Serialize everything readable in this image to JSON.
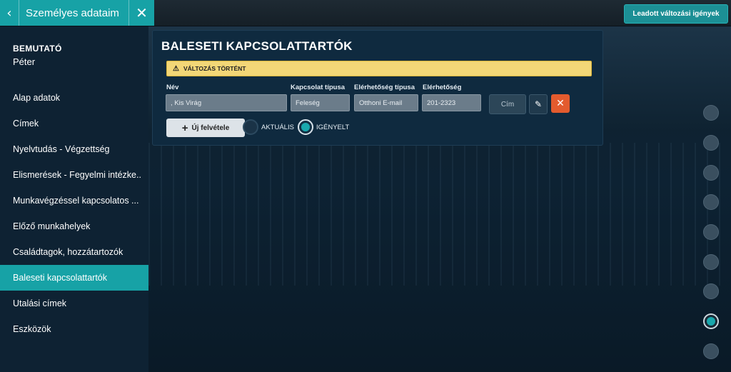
{
  "header": {
    "title": "Személyes adataim",
    "back_icon": "chevron-left-icon",
    "close_icon": "close-icon",
    "submitted_requests_label": "Leadott változási igények"
  },
  "user": {
    "label": "BEMUTATÓ",
    "name": "Péter"
  },
  "sidebar": {
    "items": [
      {
        "label": "Alap adatok"
      },
      {
        "label": "Címek"
      },
      {
        "label": "Nyelvtudás - Végzettség"
      },
      {
        "label": "Elismerések - Fegyelmi intézke.."
      },
      {
        "label": "Munkavégzéssel kapcsolatos ..."
      },
      {
        "label": "Előző munkahelyek"
      },
      {
        "label": "Családtagok, hozzátartozók"
      },
      {
        "label": "Baleseti kapcsolattartók",
        "active": true
      },
      {
        "label": "Utalási címek"
      },
      {
        "label": "Eszközök"
      }
    ]
  },
  "card": {
    "title": "BALESETI KAPCSOLATTARTÓK",
    "warning": "VÁLTOZÁS TÖRTÉNT",
    "labels": {
      "name": "Név",
      "relation_type": "Kapcsolat típusa",
      "contact_type": "Elérhetőség típusa",
      "contact": "Elérhetőség"
    },
    "row": {
      "name": ", Kis  Virág",
      "relation_type": "Feleség",
      "contact_type": "Otthoni E-mail",
      "contact": "201-2323"
    },
    "cim_button": "Cím",
    "new_button": "Új felvétele",
    "radio_current": "AKTUÁLIS",
    "radio_requested": "IGÉNYELT"
  },
  "accent_color": "#17a2a6",
  "danger_color": "#e35b2e",
  "warning_color": "#f3d777"
}
